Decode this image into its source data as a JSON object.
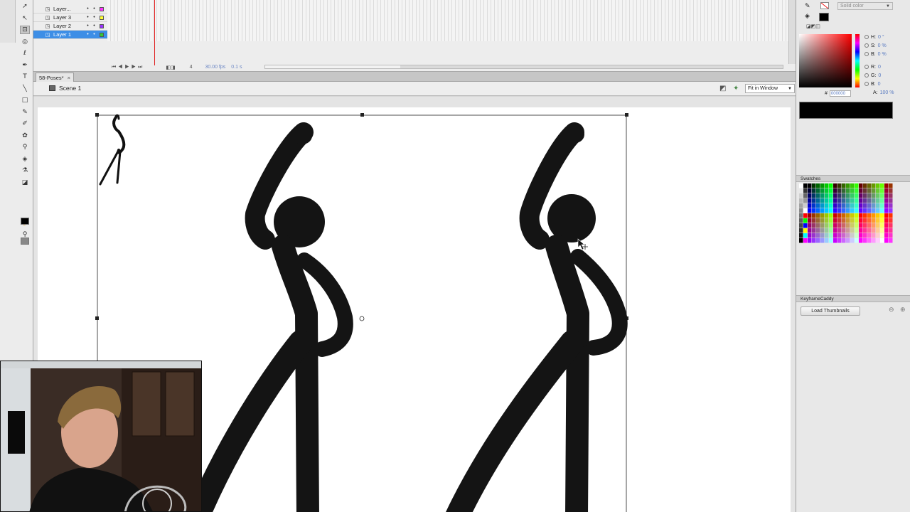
{
  "timeline": {
    "layers": [
      {
        "name": "Layer...",
        "color": "#ff33ff",
        "selected": false
      },
      {
        "name": "Layer 3",
        "color": "#ffff33",
        "selected": false
      },
      {
        "name": "Layer 2",
        "color": "#9933ff",
        "selected": false
      },
      {
        "name": "Layer 1",
        "color": "#33cc33",
        "selected": true
      }
    ],
    "fps": "30.00 fps",
    "time": "0.1 s",
    "current_frame": "4"
  },
  "document": {
    "tab_title": "58-Poses*",
    "close_symbol": "×",
    "scene": "Scene 1",
    "zoom": "Fit in Window"
  },
  "color_panel": {
    "fill_type": "Solid color",
    "hsb": [
      {
        "label": "H:",
        "value": "0 °"
      },
      {
        "label": "S:",
        "value": "0 %"
      },
      {
        "label": "B:",
        "value": "0 %"
      }
    ],
    "rgb": [
      {
        "label": "R:",
        "value": "0"
      },
      {
        "label": "G:",
        "value": "0"
      },
      {
        "label": "B:",
        "value": "0"
      }
    ],
    "hex_label": "#",
    "hex": "000000",
    "alpha_label": "A:",
    "alpha": "100 %",
    "preview_color": "#000000"
  },
  "swatches_panel": {
    "title": "Swatches"
  },
  "keyframe_panel": {
    "title": "KeyframeCaddy",
    "load_button": "Load Thumbnails"
  },
  "tools": [
    {
      "name": "selection-tool-icon",
      "glyph": "➚"
    },
    {
      "name": "subselection-tool-icon",
      "glyph": "↖"
    },
    {
      "name": "free-transform-tool-icon",
      "glyph": "⊡"
    },
    {
      "name": "3d-rotation-tool-icon",
      "glyph": "◎"
    },
    {
      "name": "lasso-tool-icon",
      "glyph": "ℓ"
    },
    {
      "name": "pen-tool-icon",
      "glyph": "✒"
    },
    {
      "name": "text-tool-icon",
      "glyph": "T"
    },
    {
      "name": "line-tool-icon",
      "glyph": "╲"
    },
    {
      "name": "rectangle-tool-icon",
      "glyph": "□"
    },
    {
      "name": "pencil-tool-icon",
      "glyph": "✎"
    },
    {
      "name": "brush-tool-icon",
      "glyph": "✐"
    },
    {
      "name": "deco-tool-icon",
      "glyph": "✿"
    },
    {
      "name": "bone-tool-icon",
      "glyph": "⚲"
    },
    {
      "name": "paint-bucket-tool-icon",
      "glyph": "◈"
    },
    {
      "name": "eyedropper-tool-icon",
      "glyph": "⚗"
    },
    {
      "name": "eraser-tool-icon",
      "glyph": "◪"
    },
    {
      "name": "hand-tool-icon",
      "glyph": "✋"
    },
    {
      "name": "zoom-tool-icon",
      "glyph": "⚲"
    }
  ]
}
